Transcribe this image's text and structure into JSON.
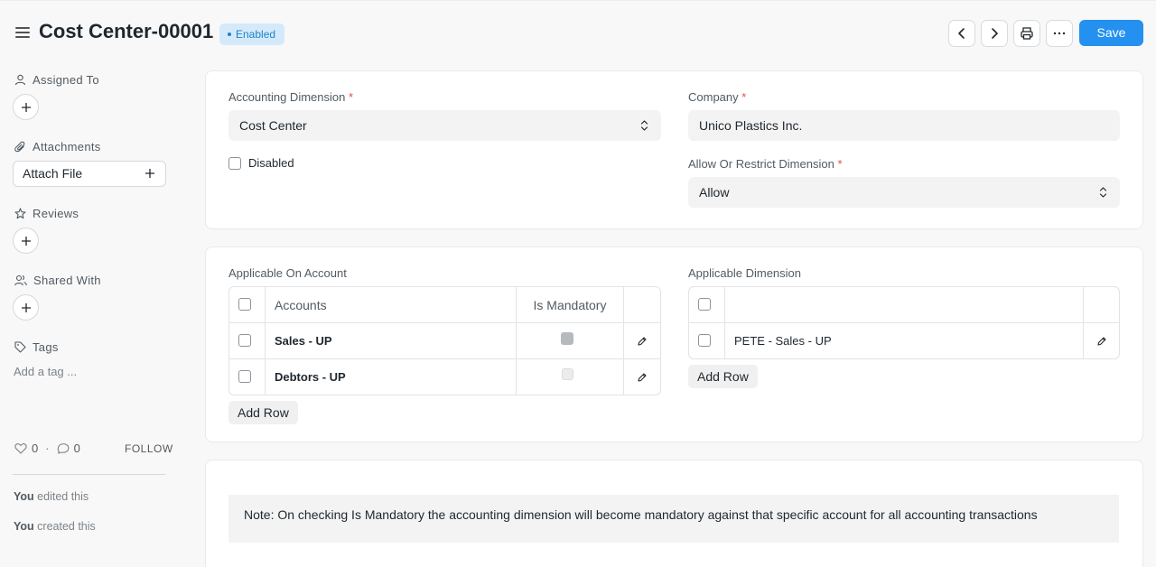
{
  "header": {
    "title": "Cost Center-00001",
    "status": "Enabled",
    "save_label": "Save",
    "prev_icon": "chevron-left-icon",
    "next_icon": "chevron-right-icon",
    "print_icon": "printer-icon",
    "more_icon": "more-horizontal-icon"
  },
  "sidebar": {
    "assigned_to": "Assigned To",
    "attachments": "Attachments",
    "attach_file": "Attach File",
    "reviews": "Reviews",
    "shared_with": "Shared With",
    "tags": "Tags",
    "add_tag_placeholder": "Add a tag ...",
    "likes": "0",
    "comments": "0",
    "follow": "FOLLOW",
    "activity": [
      {
        "user": "You",
        "text": " edited this"
      },
      {
        "user": "You",
        "text": " created this"
      }
    ]
  },
  "form": {
    "accounting_dimension_label": "Accounting Dimension",
    "accounting_dimension_value": "Cost Center",
    "company_label": "Company",
    "company_value": "Unico Plastics Inc.",
    "disabled_label": "Disabled",
    "allow_restrict_label": "Allow Or Restrict Dimension",
    "allow_restrict_value": "Allow",
    "required_mark": "*"
  },
  "accounts_table": {
    "label": "Applicable On Account",
    "columns": [
      "Accounts",
      "Is Mandatory"
    ],
    "rows": [
      {
        "account": "Sales - UP",
        "is_mandatory": true
      },
      {
        "account": "Debtors - UP",
        "is_mandatory": false
      }
    ],
    "add_row": "Add Row"
  },
  "dimension_table": {
    "label": "Applicable Dimension",
    "rows": [
      {
        "value": "PETE - Sales - UP"
      }
    ],
    "add_row": "Add Row"
  },
  "note": "Note: On checking Is Mandatory the accounting dimension will become mandatory against that specific account for all accounting transactions",
  "colors": {
    "primary": "#2490ef",
    "badge_bg": "#d4eafb",
    "badge_text": "#2182c7",
    "required": "#e24c4c"
  }
}
